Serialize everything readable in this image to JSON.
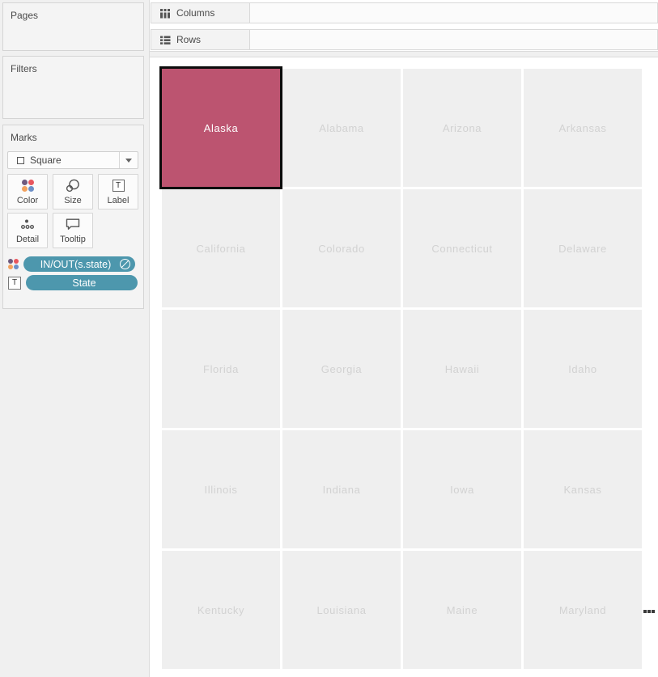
{
  "shelves": {
    "columns_label": "Columns",
    "rows_label": "Rows"
  },
  "sidebar": {
    "pages_title": "Pages",
    "filters_title": "Filters",
    "marks": {
      "title": "Marks",
      "mark_type": "Square",
      "buttons": {
        "color": "Color",
        "size": "Size",
        "label": "Label",
        "detail": "Detail",
        "tooltip": "Tooltip"
      },
      "pills": [
        {
          "label": "IN/OUT(s.state)",
          "left_icon": "color-dots-icon",
          "right_icon": "color-legend-icon"
        },
        {
          "label": "State",
          "left_icon": "text-label-icon"
        }
      ]
    }
  },
  "colors": {
    "pill": "#4d97ad",
    "selected_tile": "#bc5470",
    "selected_border": "#0c0c0c",
    "tile_bg": "#efefef",
    "tile_text": "#d2d2d2",
    "dot_purple": "#6f5b7f",
    "dot_red": "#e8565e",
    "dot_orange": "#f2a25f",
    "dot_blue": "#6c8fc7"
  },
  "grid": {
    "tiles": [
      {
        "label": "Alaska",
        "selected": true
      },
      {
        "label": "Alabama",
        "selected": false
      },
      {
        "label": "Arizona",
        "selected": false
      },
      {
        "label": "Arkansas",
        "selected": false
      },
      {
        "label": "California",
        "selected": false
      },
      {
        "label": "Colorado",
        "selected": false
      },
      {
        "label": "Connecticut",
        "selected": false
      },
      {
        "label": "Delaware",
        "selected": false
      },
      {
        "label": "Florida",
        "selected": false
      },
      {
        "label": "Georgia",
        "selected": false
      },
      {
        "label": "Hawaii",
        "selected": false
      },
      {
        "label": "Idaho",
        "selected": false
      },
      {
        "label": "Illinois",
        "selected": false
      },
      {
        "label": "Indiana",
        "selected": false
      },
      {
        "label": "Iowa",
        "selected": false
      },
      {
        "label": "Kansas",
        "selected": false
      },
      {
        "label": "Kentucky",
        "selected": false
      },
      {
        "label": "Louisiana",
        "selected": false
      },
      {
        "label": "Maine",
        "selected": false
      },
      {
        "label": "Maryland",
        "selected": false
      }
    ]
  }
}
